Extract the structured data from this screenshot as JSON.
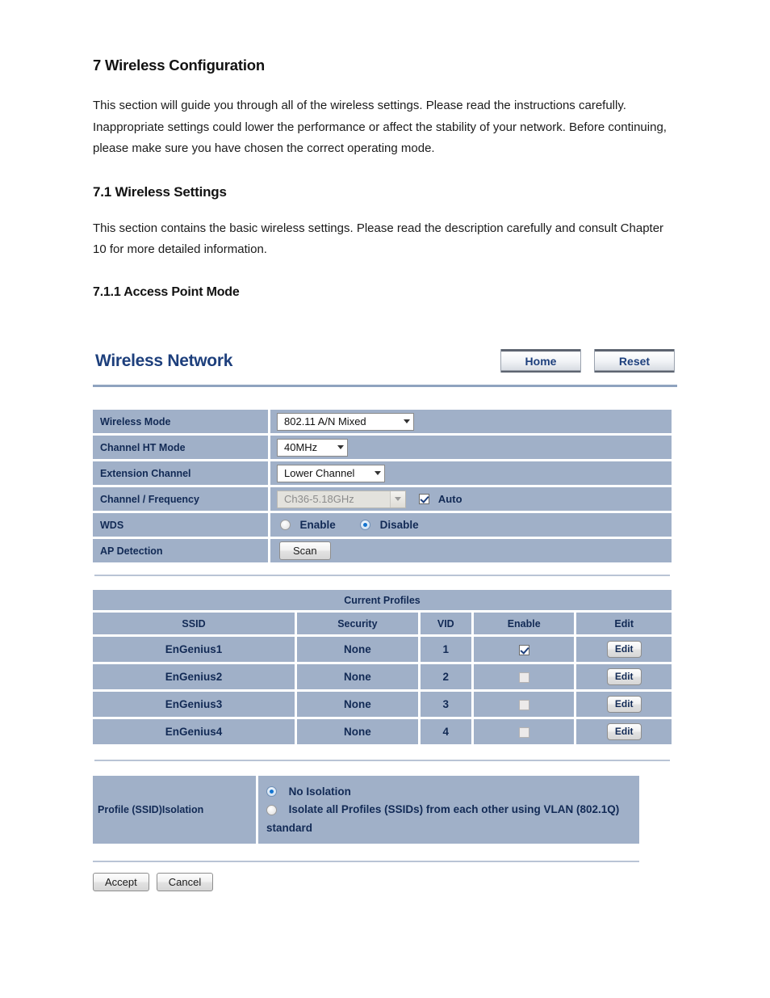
{
  "document": {
    "h1": "7 Wireless Configuration",
    "intro": "This section will guide you through all of the wireless settings. Please read the instructions carefully. Inappropriate settings could lower the performance or affect the stability of your network. Before continuing, please make sure you have chosen the correct operating mode.",
    "h2": "7.1 Wireless Settings",
    "section_text": "This section contains the basic wireless settings. Please read the description carefully and consult Chapter 10 for more detailed information.",
    "h3": "7.1.1 Access Point Mode"
  },
  "screenshot": {
    "title": "Wireless Network",
    "header_buttons": {
      "home": "Home",
      "reset": "Reset"
    },
    "settings": {
      "wireless_mode": {
        "label": "Wireless Mode",
        "value": "802.11 A/N Mixed"
      },
      "channel_ht_mode": {
        "label": "Channel HT Mode",
        "value": "40MHz"
      },
      "extension_channel": {
        "label": "Extension Channel",
        "value": "Lower Channel"
      },
      "channel_frequency": {
        "label": "Channel / Frequency",
        "value": "Ch36-5.18GHz",
        "auto_label": "Auto",
        "auto_checked": true,
        "select_disabled": true
      },
      "wds": {
        "label": "WDS",
        "enable_label": "Enable",
        "disable_label": "Disable",
        "selected": "Disable"
      },
      "ap_detection": {
        "label": "AP Detection",
        "scan_label": "Scan"
      }
    },
    "profiles": {
      "title": "Current Profiles",
      "columns": [
        "SSID",
        "Security",
        "VID",
        "Enable",
        "Edit"
      ],
      "edit_label": "Edit",
      "rows": [
        {
          "ssid": "EnGenius1",
          "security": "None",
          "vid": "1",
          "enabled": true
        },
        {
          "ssid": "EnGenius2",
          "security": "None",
          "vid": "2",
          "enabled": false
        },
        {
          "ssid": "EnGenius3",
          "security": "None",
          "vid": "3",
          "enabled": false
        },
        {
          "ssid": "EnGenius4",
          "security": "None",
          "vid": "4",
          "enabled": false
        }
      ]
    },
    "isolation": {
      "label": "Profile (SSID)Isolation",
      "option_none": "No Isolation",
      "option_vlan": "Isolate all Profiles (SSIDs) from each other using VLAN (802.1Q) standard",
      "selected": "No Isolation"
    },
    "footer": {
      "accept": "Accept",
      "cancel": "Cancel"
    },
    "colors": {
      "row_blue": "#a0b0c8",
      "title_navy": "#1d3f7c",
      "text_navy": "#122a55",
      "rule_blue": "#8fa3bf"
    }
  }
}
